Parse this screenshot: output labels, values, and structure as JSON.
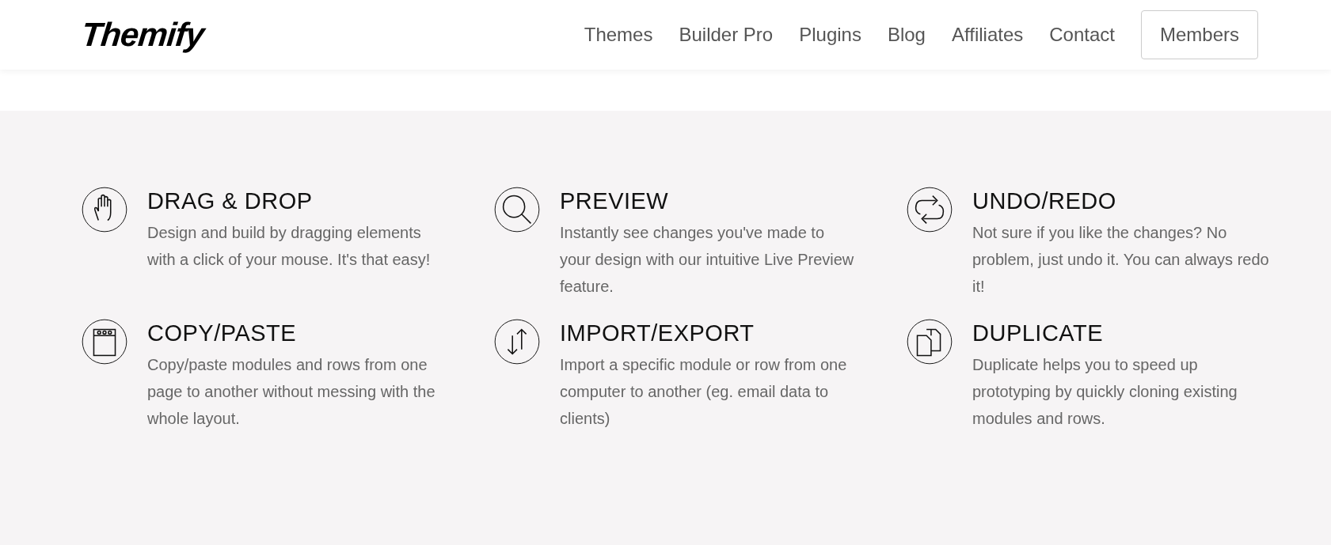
{
  "header": {
    "logo": "Themify",
    "nav": [
      {
        "label": "Themes",
        "kind": "link"
      },
      {
        "label": "Builder Pro",
        "kind": "link"
      },
      {
        "label": "Plugins",
        "kind": "link"
      },
      {
        "label": "Blog",
        "kind": "link"
      },
      {
        "label": "Affiliates",
        "kind": "link"
      },
      {
        "label": "Contact",
        "kind": "link"
      },
      {
        "label": "Members",
        "kind": "button"
      }
    ]
  },
  "features": [
    {
      "title": "DRAG & DROP",
      "text": "Design and build by dragging elements with a click of your mouse. It's that easy!"
    },
    {
      "title": "PREVIEW",
      "text": "Instantly see changes you've made to your design with our intuitive Live Preview feature."
    },
    {
      "title": "UNDO/REDO",
      "text": "Not sure if you like the changes? No problem, just undo it. You can always redo it!"
    },
    {
      "title": "COPY/PASTE",
      "text": "Copy/paste modules and rows from one page to another without messing with the whole layout."
    },
    {
      "title": "IMPORT/EXPORT",
      "text": "Import a specific module or row from one computer to another (eg. email data to clients)"
    },
    {
      "title": "DUPLICATE",
      "text": "Duplicate helps you to speed up prototyping by quickly cloning existing modules and rows."
    }
  ]
}
